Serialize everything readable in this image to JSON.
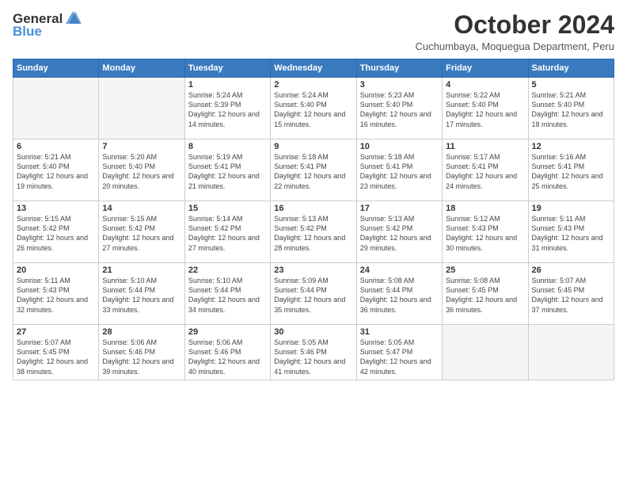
{
  "logo": {
    "general": "General",
    "blue": "Blue"
  },
  "title": "October 2024",
  "subtitle": "Cuchumbaya, Moquegua Department, Peru",
  "weekdays": [
    "Sunday",
    "Monday",
    "Tuesday",
    "Wednesday",
    "Thursday",
    "Friday",
    "Saturday"
  ],
  "weeks": [
    [
      {
        "day": "",
        "info": ""
      },
      {
        "day": "",
        "info": ""
      },
      {
        "day": "1",
        "info": "Sunrise: 5:24 AM\nSunset: 5:39 PM\nDaylight: 12 hours and 14 minutes."
      },
      {
        "day": "2",
        "info": "Sunrise: 5:24 AM\nSunset: 5:40 PM\nDaylight: 12 hours and 15 minutes."
      },
      {
        "day": "3",
        "info": "Sunrise: 5:23 AM\nSunset: 5:40 PM\nDaylight: 12 hours and 16 minutes."
      },
      {
        "day": "4",
        "info": "Sunrise: 5:22 AM\nSunset: 5:40 PM\nDaylight: 12 hours and 17 minutes."
      },
      {
        "day": "5",
        "info": "Sunrise: 5:21 AM\nSunset: 5:40 PM\nDaylight: 12 hours and 18 minutes."
      }
    ],
    [
      {
        "day": "6",
        "info": "Sunrise: 5:21 AM\nSunset: 5:40 PM\nDaylight: 12 hours and 19 minutes."
      },
      {
        "day": "7",
        "info": "Sunrise: 5:20 AM\nSunset: 5:40 PM\nDaylight: 12 hours and 20 minutes."
      },
      {
        "day": "8",
        "info": "Sunrise: 5:19 AM\nSunset: 5:41 PM\nDaylight: 12 hours and 21 minutes."
      },
      {
        "day": "9",
        "info": "Sunrise: 5:18 AM\nSunset: 5:41 PM\nDaylight: 12 hours and 22 minutes."
      },
      {
        "day": "10",
        "info": "Sunrise: 5:18 AM\nSunset: 5:41 PM\nDaylight: 12 hours and 23 minutes."
      },
      {
        "day": "11",
        "info": "Sunrise: 5:17 AM\nSunset: 5:41 PM\nDaylight: 12 hours and 24 minutes."
      },
      {
        "day": "12",
        "info": "Sunrise: 5:16 AM\nSunset: 5:41 PM\nDaylight: 12 hours and 25 minutes."
      }
    ],
    [
      {
        "day": "13",
        "info": "Sunrise: 5:15 AM\nSunset: 5:42 PM\nDaylight: 12 hours and 26 minutes."
      },
      {
        "day": "14",
        "info": "Sunrise: 5:15 AM\nSunset: 5:42 PM\nDaylight: 12 hours and 27 minutes."
      },
      {
        "day": "15",
        "info": "Sunrise: 5:14 AM\nSunset: 5:42 PM\nDaylight: 12 hours and 27 minutes."
      },
      {
        "day": "16",
        "info": "Sunrise: 5:13 AM\nSunset: 5:42 PM\nDaylight: 12 hours and 28 minutes."
      },
      {
        "day": "17",
        "info": "Sunrise: 5:13 AM\nSunset: 5:42 PM\nDaylight: 12 hours and 29 minutes."
      },
      {
        "day": "18",
        "info": "Sunrise: 5:12 AM\nSunset: 5:43 PM\nDaylight: 12 hours and 30 minutes."
      },
      {
        "day": "19",
        "info": "Sunrise: 5:11 AM\nSunset: 5:43 PM\nDaylight: 12 hours and 31 minutes."
      }
    ],
    [
      {
        "day": "20",
        "info": "Sunrise: 5:11 AM\nSunset: 5:43 PM\nDaylight: 12 hours and 32 minutes."
      },
      {
        "day": "21",
        "info": "Sunrise: 5:10 AM\nSunset: 5:44 PM\nDaylight: 12 hours and 33 minutes."
      },
      {
        "day": "22",
        "info": "Sunrise: 5:10 AM\nSunset: 5:44 PM\nDaylight: 12 hours and 34 minutes."
      },
      {
        "day": "23",
        "info": "Sunrise: 5:09 AM\nSunset: 5:44 PM\nDaylight: 12 hours and 35 minutes."
      },
      {
        "day": "24",
        "info": "Sunrise: 5:08 AM\nSunset: 5:44 PM\nDaylight: 12 hours and 36 minutes."
      },
      {
        "day": "25",
        "info": "Sunrise: 5:08 AM\nSunset: 5:45 PM\nDaylight: 12 hours and 36 minutes."
      },
      {
        "day": "26",
        "info": "Sunrise: 5:07 AM\nSunset: 5:45 PM\nDaylight: 12 hours and 37 minutes."
      }
    ],
    [
      {
        "day": "27",
        "info": "Sunrise: 5:07 AM\nSunset: 5:45 PM\nDaylight: 12 hours and 38 minutes."
      },
      {
        "day": "28",
        "info": "Sunrise: 5:06 AM\nSunset: 5:46 PM\nDaylight: 12 hours and 39 minutes."
      },
      {
        "day": "29",
        "info": "Sunrise: 5:06 AM\nSunset: 5:46 PM\nDaylight: 12 hours and 40 minutes."
      },
      {
        "day": "30",
        "info": "Sunrise: 5:05 AM\nSunset: 5:46 PM\nDaylight: 12 hours and 41 minutes."
      },
      {
        "day": "31",
        "info": "Sunrise: 5:05 AM\nSunset: 5:47 PM\nDaylight: 12 hours and 42 minutes."
      },
      {
        "day": "",
        "info": ""
      },
      {
        "day": "",
        "info": ""
      }
    ]
  ]
}
